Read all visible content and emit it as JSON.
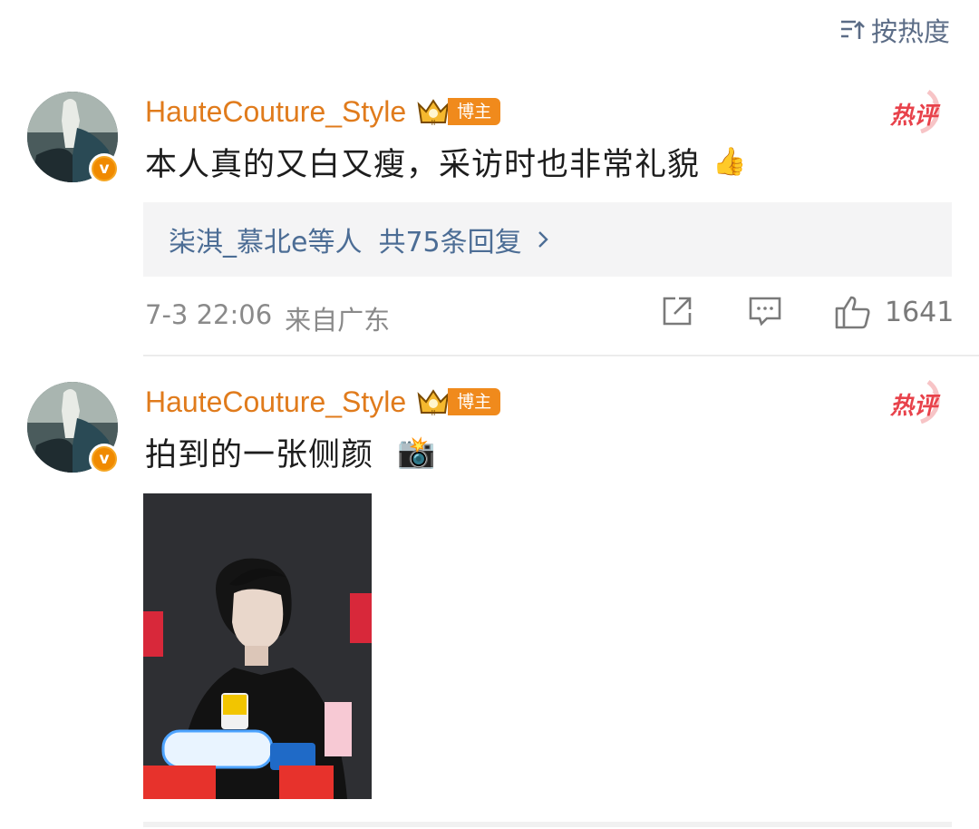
{
  "sort": {
    "label": "按热度"
  },
  "comments": [
    {
      "username": "HauteCouture_Style",
      "badge": "博主",
      "hot_tag": "热评",
      "text": "本人真的又白又瘦，采访时也非常礼貌",
      "emoji": "👍",
      "replies_users": "柒淇_慕北e等人",
      "replies_count": "共75条回复",
      "time": "7-3 22:06",
      "location": "来自广东",
      "likes": "1641"
    },
    {
      "username": "HauteCouture_Style",
      "badge": "博主",
      "hot_tag": "热评",
      "text": "拍到的一张侧颜",
      "emoji": "📸"
    }
  ],
  "colors": {
    "username": "#e07b1c",
    "link": "#4c6d95",
    "hot": "#e8424b",
    "badge": "#f08a1c"
  }
}
